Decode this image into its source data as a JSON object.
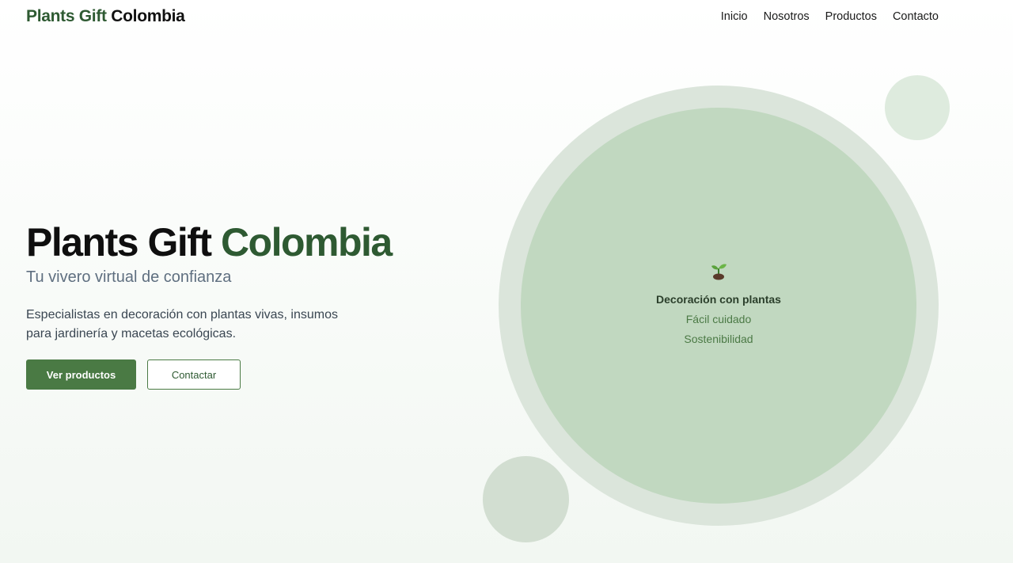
{
  "header": {
    "logo_part1": "Plants Gift",
    "logo_part2": "Colombia",
    "nav": [
      "Inicio",
      "Nosotros",
      "Productos",
      "Contacto"
    ]
  },
  "hero": {
    "title_part1": "Plants Gift",
    "title_part2": "Colombia",
    "subtitle": "Tu vivero virtual de confianza",
    "description": "Especialistas en decoración con plantas vivas, insumos para jardinería y macetas ecológicas.",
    "primary_button": "Ver productos",
    "secondary_button": "Contactar"
  },
  "feature_circle": {
    "icon": "sprout-icon",
    "main": "Decoración con plantas",
    "items": [
      "Fácil cuidado",
      "Sostenibilidad"
    ]
  },
  "colors": {
    "brand_green": "#2e5a32",
    "button_green": "#4a7a44",
    "circle_inner": "#c1d8c0",
    "circle_ring": "#dbe5db"
  }
}
